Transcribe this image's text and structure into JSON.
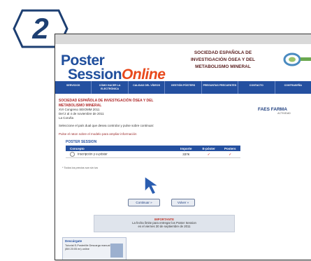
{
  "step": {
    "number": "2"
  },
  "app": {
    "logo_line1": "Poster",
    "logo_line2a": "Session",
    "logo_line2b": "Online",
    "society_line1": "SOCIEDAD ESPAÑOLA DE",
    "society_line2": "INVESTIGACIÓN ÓSEA Y DEL",
    "society_line3": "METABOLISMO MINERAL"
  },
  "nav": {
    "items": [
      "SERVICIOS",
      "CÓMO HACER LA ELECTRÓNICA",
      "CALIDAD DEL VÍDEOS",
      "GESTIÓN PÓSTERS",
      "PREGUNTAS FRECUENTES",
      "CONTACTO",
      "CONTRASEÑA"
    ]
  },
  "content": {
    "conf_title_1": "SOCIEDAD ESPAÑOLA DE INVESTIGACIÓN ÓSEA Y DEL",
    "conf_title_2": "METABOLISMO MINERAL",
    "conf_sub_1": "XVI Congreso SEIOMM 2011",
    "conf_sub_2": "Del 2 al 4 de noviembre de 2011",
    "conf_sub_3": "La Coruña",
    "instructions": "Seleccione el país dual que desea controlar y pulse sobre continuar:",
    "note": "Pulse el raton sobre el modelo para ampliar información",
    "poster_header": "POSTER SESSION"
  },
  "sponsor": {
    "name": "FAES FARMA",
    "sub": "ACTIVIDAD"
  },
  "table": {
    "headers": [
      "Concepto",
      "Importe",
      "E-póster",
      "Posters"
    ],
    "rows": [
      {
        "concepto": "Inscripción y e-póster",
        "importe": "337€",
        "eposter": "✓",
        "posters": "✓"
      }
    ]
  },
  "footnote": "* Todos los precios son sin iva",
  "buttons": {
    "continue": "Continuar »",
    "back": "Volver »"
  },
  "info": {
    "alert": "IMPORTANTE",
    "line1": "La fecha límite para entregar los Poster Session",
    "line2": "es el viernes 30 de septiembre de 2011"
  },
  "bottom_panel": {
    "head": "Descárgate",
    "line1": "Tutorial E-PosterMe Descarga manual",
    "line2": "(8M 20:05 en) online"
  },
  "colors": {
    "nav": "#2450a0",
    "accent": "#e8491c",
    "title_red": "#b02a2a"
  }
}
